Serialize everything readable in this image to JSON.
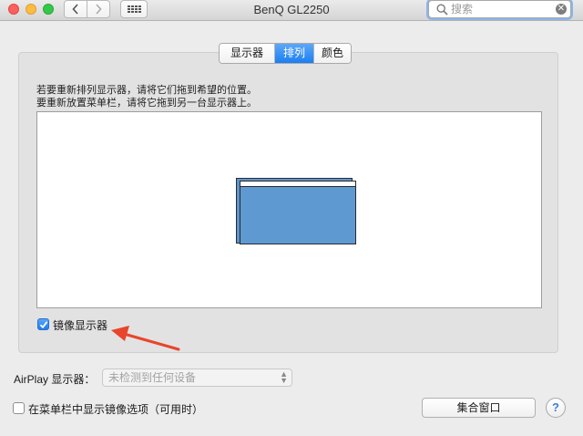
{
  "window": {
    "title": "BenQ GL2250"
  },
  "toolbar": {
    "search_placeholder": "搜索",
    "clear_glyph": "✕"
  },
  "tabs": [
    {
      "label": "显示器",
      "selected": false
    },
    {
      "label": "排列",
      "selected": true
    },
    {
      "label": "颜色",
      "selected": false
    }
  ],
  "arrangement": {
    "instruction_1": "若要重新排列显示器，请将它们拖到希望的位置。",
    "instruction_2": "要重新放置菜单栏，请将它拖到另一台显示器上。",
    "mirror_label": "镜像显示器",
    "mirror_checked": true
  },
  "airplay": {
    "label": "AirPlay 显示器：",
    "selected": "未检测到任何设备"
  },
  "footer": {
    "menubar_option_label": "在菜单栏中显示镜像选项（可用时）",
    "menubar_option_checked": false,
    "gather_button": "集合窗口",
    "help_glyph": "?"
  },
  "colors": {
    "accent": "#1a7ff3",
    "display_fill": "#5f99d2",
    "annotation_arrow": "#e8452c"
  }
}
